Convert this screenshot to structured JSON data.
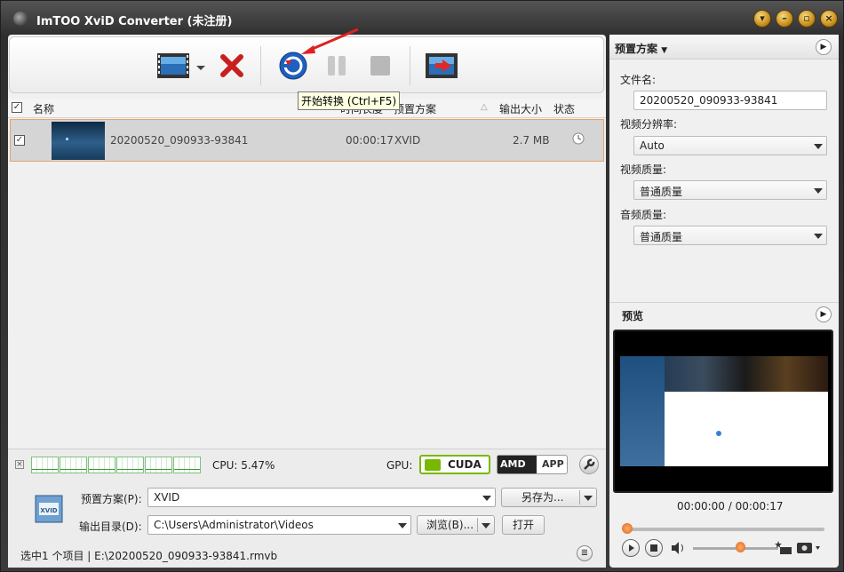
{
  "window": {
    "title": "ImTOO XviD Converter (未注册)"
  },
  "tooltip": "开始转换 (Ctrl+F5)",
  "columns": {
    "name": "名称",
    "duration": "时间长度",
    "profile": "预置方案",
    "size": "输出大小",
    "status": "状态"
  },
  "files": [
    {
      "name": "20200520_090933-93841",
      "duration": "00:00:17",
      "profile": "XVID",
      "size": "2.7 MB",
      "checked": true
    }
  ],
  "status_bar": {
    "cpu": "CPU: 5.47%",
    "gpu_label": "GPU:",
    "cuda": "CUDA",
    "amd": "AMD",
    "app": "APP"
  },
  "bottom": {
    "profile_label": "预置方案(P):",
    "profile_value": "XVID",
    "save_as": "另存为...",
    "output_label": "输出目录(D):",
    "output_value": "C:\\Users\\Administrator\\Videos",
    "browse": "浏览(B)...",
    "open": "打开",
    "selection": "选中1 个项目 | E:\\20200520_090933-93841.rmvb"
  },
  "right_panel": {
    "header": "预置方案",
    "filename_label": "文件名:",
    "filename_value": "20200520_090933-93841",
    "resolution_label": "视频分辨率:",
    "resolution_value": "Auto",
    "video_quality_label": "视频质量:",
    "video_quality_value": "普通质量",
    "audio_quality_label": "音频质量:",
    "audio_quality_value": "普通质量",
    "preview_label": "预览",
    "time": "00:00:00 / 00:00:17"
  },
  "colors": {
    "accent": "#e5a56a",
    "cuda_green": "#76b900"
  }
}
